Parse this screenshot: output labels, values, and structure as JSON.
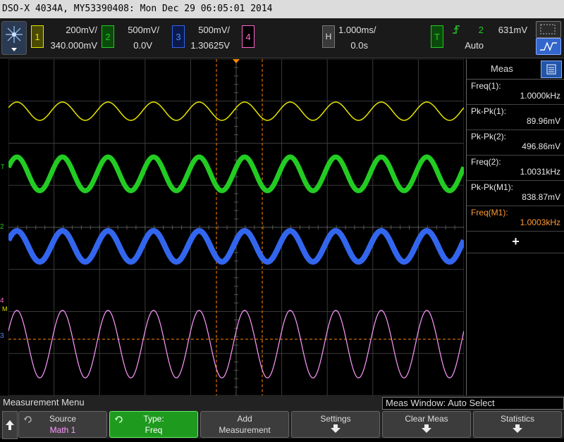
{
  "title_bar": {
    "text": "DSO-X 4034A, MY53390408: Mon Dec 29 06:05:01 2014"
  },
  "channels": [
    {
      "num": "1",
      "volts_div": "200mV/",
      "offset": "340.000mV",
      "color": "#e6e600"
    },
    {
      "num": "2",
      "volts_div": "500mV/",
      "offset": "0.0V",
      "color": "#22cc22"
    },
    {
      "num": "3",
      "volts_div": "500mV/",
      "offset": "1.30625V",
      "color": "#3366ee"
    },
    {
      "num": "4",
      "volts_div": "",
      "offset": "",
      "color": "#ff66cc"
    }
  ],
  "horizontal": {
    "label": "H",
    "time_div": "1.000ms/",
    "delay": "0.0s"
  },
  "trigger": {
    "label": "T",
    "source": "2",
    "level": "631mV",
    "mode": "Auto",
    "color": "#22cc22"
  },
  "meas_panel": {
    "title": "Meas",
    "items": [
      {
        "label": "Freq(1):",
        "value": "1.0000kHz",
        "color": "#e8e8e8"
      },
      {
        "label": "Pk-Pk(1):",
        "value": "89.96mV",
        "color": "#e8e8e8"
      },
      {
        "label": "Pk-Pk(2):",
        "value": "496.86mV",
        "color": "#e8e8e8"
      },
      {
        "label": "Freq(2):",
        "value": "1.0031kHz",
        "color": "#e8e8e8"
      },
      {
        "label": "Pk-Pk(M1):",
        "value": "838.87mV",
        "color": "#e8e8e8"
      },
      {
        "label": "Freq(M1):",
        "value": "1.0003kHz",
        "color": "#ff9933"
      }
    ],
    "add_symbol": "+"
  },
  "menu": {
    "title": "Measurement Menu",
    "meas_window": "Meas Window: Auto Select",
    "softkeys": [
      {
        "l1": "Source",
        "l2": "Math 1"
      },
      {
        "l1": "Type:",
        "l2": "Freq"
      },
      {
        "l1": "Add",
        "l2": "Measurement"
      },
      {
        "l1": "Settings",
        "l2": ""
      },
      {
        "l1": "Clear Meas",
        "l2": ""
      },
      {
        "l1": "Statistics",
        "l2": ""
      }
    ]
  },
  "waveforms": {
    "cycles": 10,
    "traces": [
      {
        "name": "ch1",
        "color": "#e6e600"
      },
      {
        "name": "ch2",
        "color": "#22cc22"
      },
      {
        "name": "ch3",
        "color": "#3366ee"
      },
      {
        "name": "math",
        "color": "#ff99ff"
      }
    ]
  },
  "ground_markers": {
    "ch1": "T",
    "ch2": "2",
    "ch3": "3",
    "ch4": "4",
    "math": "M"
  }
}
